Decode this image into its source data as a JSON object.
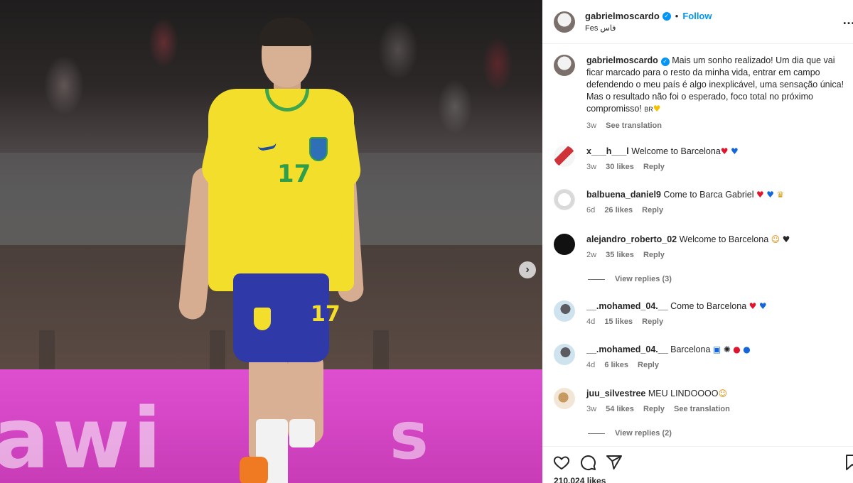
{
  "post": {
    "username": "gabrielmoscardo",
    "follow_label": "Follow",
    "dot": "•",
    "location": "Fes فاس",
    "caption": "Mais um sonho realizado! Um dia que vai ficar marcado para o resto da minha vida, entrar em campo defendendo o meu país é algo inexplicável, uma sensação única! Mas o resultado não foi o esperado, foco total no próximo compromisso! ",
    "caption_flag": "BR",
    "caption_heart": "♥",
    "caption_time": "3w",
    "see_translation": "See translation",
    "likes_count": "210,024 likes",
    "more": "…"
  },
  "photo": {
    "board_text": "awi",
    "board_s": "s",
    "shirt_number": "17",
    "shorts_number": "17"
  },
  "comments": [
    {
      "user": "x___h___l",
      "text": "Welcome to Barcelona",
      "emojis": [
        "♥",
        "♥"
      ],
      "time": "3w",
      "likes": "30 likes",
      "reply": "Reply"
    },
    {
      "user": "balbuena_daniel9",
      "text": "Come to Barca Gabriel",
      "emojis": [
        "♥",
        "♥",
        "♛"
      ],
      "time": "6d",
      "likes": "26 likes",
      "reply": "Reply"
    },
    {
      "user": "alejandro_roberto_02",
      "text": "Welcome to Barcelona",
      "emojis": [
        "☺",
        "♥"
      ],
      "time": "2w",
      "likes": "35 likes",
      "reply": "Reply",
      "view_replies": "View replies (3)"
    },
    {
      "user": "__.mohamed_04.__",
      "text": "Come to Barcelona",
      "emojis": [
        "♥",
        "♥"
      ],
      "time": "4d",
      "likes": "15 likes",
      "reply": "Reply"
    },
    {
      "user": "__.mohamed_04.__",
      "text": "Barcelona",
      "emojis": [
        "▣",
        "✺",
        "●",
        "●"
      ],
      "time": "4d",
      "likes": "6 likes",
      "reply": "Reply"
    },
    {
      "user": "juu_silvestree",
      "text": "MEU LINDOOOO",
      "emojis": [
        "☺"
      ],
      "time": "3w",
      "likes": "54 likes",
      "reply": "Reply",
      "see_translation": "See translation",
      "view_replies": "View replies (2)"
    }
  ],
  "icons": {
    "like": "heart-icon",
    "comment": "comment-icon",
    "share": "share-icon",
    "save": "bookmark-icon",
    "next": "chevron-right-icon"
  },
  "colors": {
    "accent": "#0095f6",
    "shirt": "#f3df2b",
    "shorts": "#2f3aa8",
    "board": "#d945c6"
  }
}
